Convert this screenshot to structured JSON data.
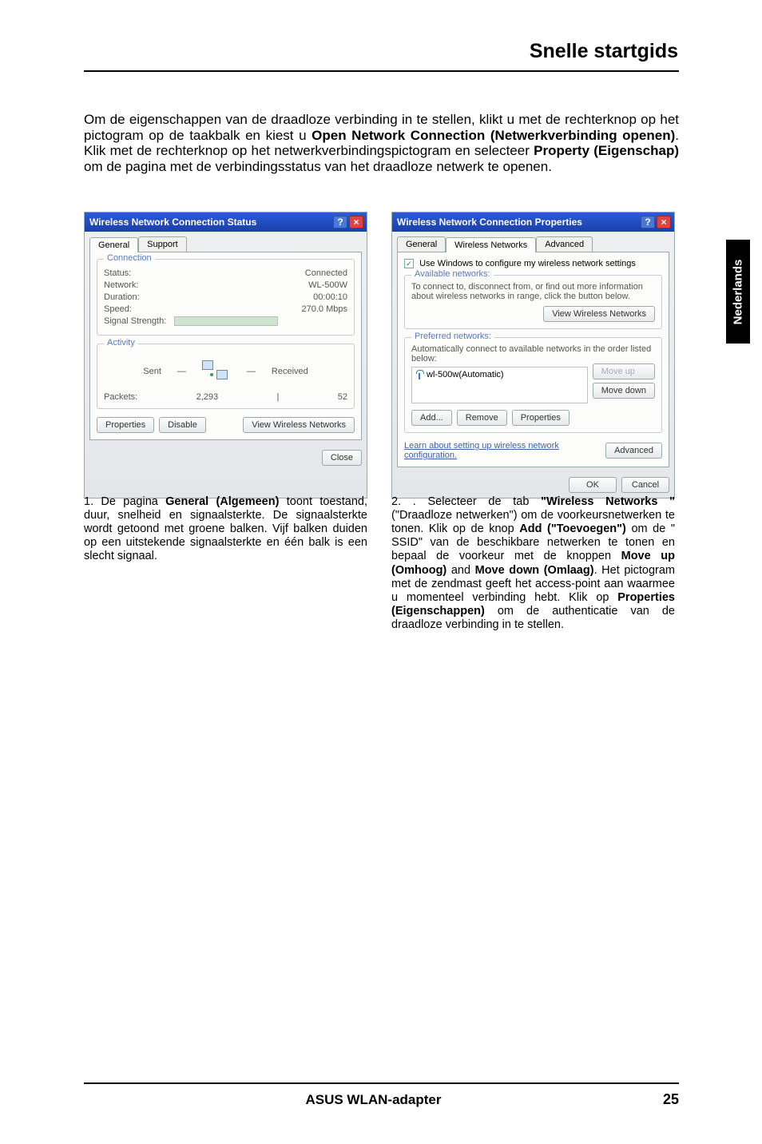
{
  "header": {
    "title": "Snelle startgids"
  },
  "side_tab": "Nederlands",
  "intro": {
    "t1": "Om de eigenschappen van de draadloze verbinding in te stellen, klikt u met de rechterknop op het pictogram op de taakbalk en kiest u ",
    "b1": "Open Network Connection (Netwerkverbinding openen)",
    "t2": ". Klik met de rechterknop op het netwerkverbindingspictogram en selecteer ",
    "b2": "Property (Eigenschap)",
    "t3": " om de pagina met de verbindingsstatus van het draadloze netwerk te openen."
  },
  "dialog1": {
    "title": "Wireless Network Connection Status",
    "tabs": {
      "general": "General",
      "support": "Support"
    },
    "conn": {
      "legend": "Connection",
      "status_l": "Status:",
      "status_v": "Connected",
      "network_l": "Network:",
      "network_v": "WL-500W",
      "duration_l": "Duration:",
      "duration_v": "00:00:10",
      "speed_l": "Speed:",
      "speed_v": "270.0 Mbps",
      "signal_l": "Signal Strength:"
    },
    "activity": {
      "legend": "Activity",
      "sent": "Sent",
      "received": "Received",
      "packets_l": "Packets:",
      "sent_v": "2,293",
      "recv_v": "52"
    },
    "buttons": {
      "properties": "Properties",
      "disable": "Disable",
      "view": "View Wireless Networks"
    },
    "close": "Close"
  },
  "dialog2": {
    "title": "Wireless Network Connection Properties",
    "tabs": {
      "general": "General",
      "wireless": "Wireless Networks",
      "advanced": "Advanced"
    },
    "chk_label": "Use Windows to configure my wireless network settings",
    "avail": {
      "legend": "Available networks:",
      "desc": "To connect to, disconnect from, or find out more information about wireless networks in range, click the button below.",
      "btn": "View Wireless Networks"
    },
    "pref": {
      "legend": "Preferred networks:",
      "desc": "Automatically connect to available networks in the order listed below:",
      "item": "wl-500w(Automatic)",
      "moveup": "Move up",
      "movedown": "Move down",
      "add": "Add...",
      "remove": "Remove",
      "props": "Properties"
    },
    "learn": {
      "text": "Learn about setting up wireless network configuration.",
      "btn": "Advanced"
    },
    "ok": "OK",
    "cancel": "Cancel"
  },
  "caption1": {
    "num": "1. ",
    "t1": "De pagina ",
    "b1": "General (Algemeen)",
    "t2": " toont toestand, duur, snelheid en signaalsterkte. De signaalsterkte wordt getoond met groene balken. Vijf balken duiden op een uitstekende signaalsterkte en één balk is een slecht signaal."
  },
  "caption2": {
    "num": "2. ",
    "t1": ". Selecteer de tab ",
    "b1": "\"Wireless Networks \"",
    "t2": " (\"Draadloze netwerken\") om de voorkeursnetwerken te tonen. Klik op de knop ",
    "b2": "Add (\"Toevoegen\")",
    "t3": " om de \" SSID\" van de beschikbare netwerken te tonen en bepaal de voorkeur met de knoppen ",
    "b3": "Move up (Omhoog)",
    "t4": " and ",
    "b4": "Move down (Omlaag)",
    "t5": ". Het pictogram met de zendmast geeft het access-point aan waarmee u momenteel verbinding hebt. Klik op ",
    "b5": "Properties (Eigenschappen)",
    "t6": " om de authenticatie van de draadloze verbinding in te stellen."
  },
  "footer": {
    "product": "ASUS WLAN-adapter",
    "page": "25"
  }
}
